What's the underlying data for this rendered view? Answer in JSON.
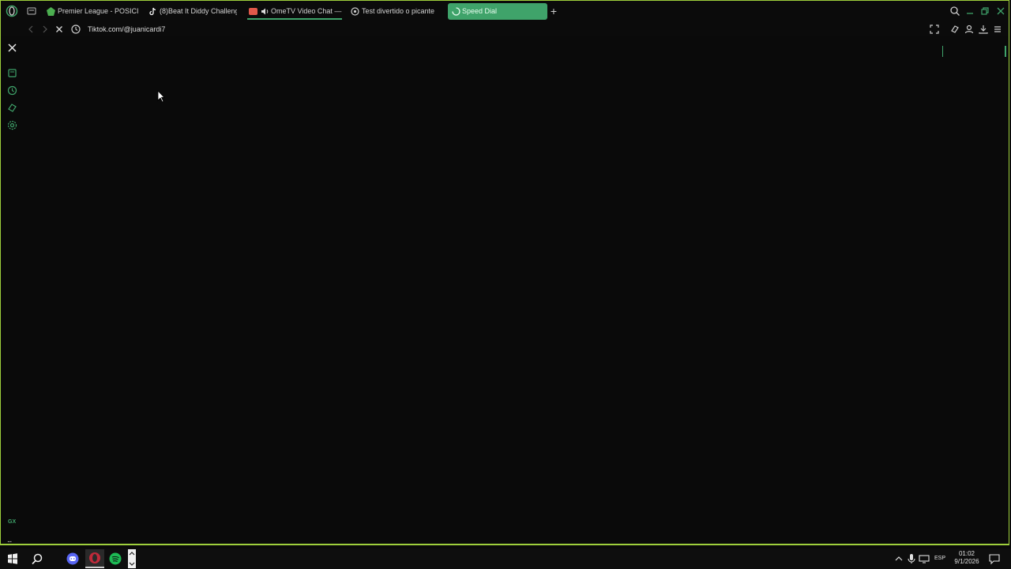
{
  "tabs": [
    {
      "label": "Premier League - POSICIO",
      "icon": "premier-league-icon"
    },
    {
      "label": "(8)Beat It Diddy Challenge",
      "icon": "tiktok-icon"
    },
    {
      "label": "OmeTV Video Chat —",
      "icon": "ometv-icon"
    },
    {
      "label": "Test divertido o picante",
      "icon": "site-icon"
    },
    {
      "label": "Speed Dial",
      "icon": "loading-icon",
      "active": true
    }
  ],
  "new_tab": "+",
  "address": {
    "url": "Tiktok.com/@juanicardi7"
  },
  "sidebar": {
    "gx_label": "GX",
    "more_label": "..."
  },
  "taskbar": {
    "lang": "ESP",
    "time": "01:02",
    "date": "9/1/2026"
  },
  "colors": {
    "accent": "#3fa36a",
    "frame": "#9ecf3c",
    "background": "#0a0a0a"
  }
}
